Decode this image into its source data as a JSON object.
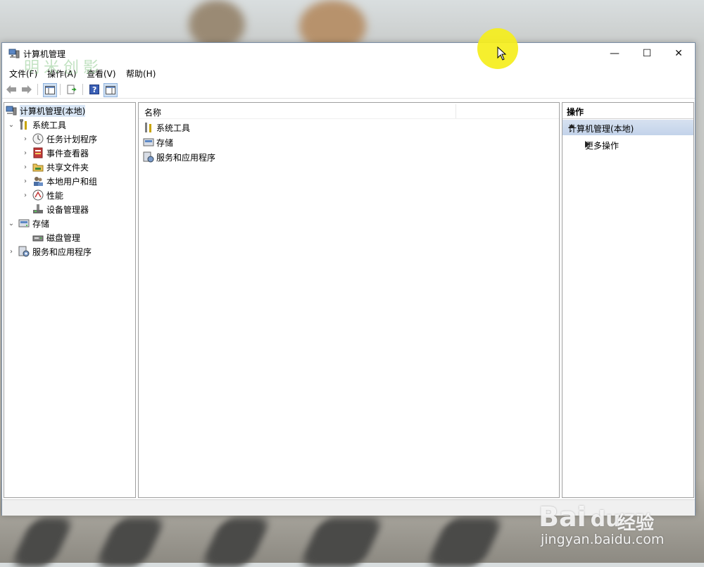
{
  "window": {
    "title": "计算机管理",
    "minimize_symbol": "—",
    "maximize_symbol": "☐",
    "close_symbol": "✕"
  },
  "menu": [
    {
      "label": "文件(F)"
    },
    {
      "label": "操作(A)"
    },
    {
      "label": "查看(V)"
    },
    {
      "label": "帮助(H)"
    }
  ],
  "toolbar": {
    "icons": [
      "back-arrow-icon",
      "forward-arrow-icon",
      "show-hide-tree-icon",
      "export-list-icon",
      "help-icon",
      "show-hide-action-pane-icon"
    ]
  },
  "tree": {
    "root": {
      "label": "计算机管理(本地)"
    },
    "system_tools": {
      "label": "系统工具"
    },
    "task_scheduler": {
      "label": "任务计划程序"
    },
    "event_viewer": {
      "label": "事件查看器"
    },
    "shared_folders": {
      "label": "共享文件夹"
    },
    "local_users": {
      "label": "本地用户和组"
    },
    "performance": {
      "label": "性能"
    },
    "device_manager": {
      "label": "设备管理器"
    },
    "storage": {
      "label": "存储"
    },
    "disk_management": {
      "label": "磁盘管理"
    },
    "services_apps": {
      "label": "服务和应用程序"
    }
  },
  "center": {
    "column_name": "名称",
    "items": [
      {
        "label": "系统工具"
      },
      {
        "label": "存储"
      },
      {
        "label": "服务和应用程序"
      }
    ]
  },
  "actions": {
    "title": "操作",
    "group": "计算机管理(本地)",
    "more": "更多操作"
  },
  "watermark": {
    "top": "明米创影",
    "baidu": "Bai",
    "baidu_du": "du",
    "baidu_cn": "经验",
    "url": "jingyan.baidu.com"
  },
  "colors": {
    "selection": "#d9e6f5",
    "action_group": "#c3d3ea",
    "cursor_highlight": "#f5ee1c"
  }
}
